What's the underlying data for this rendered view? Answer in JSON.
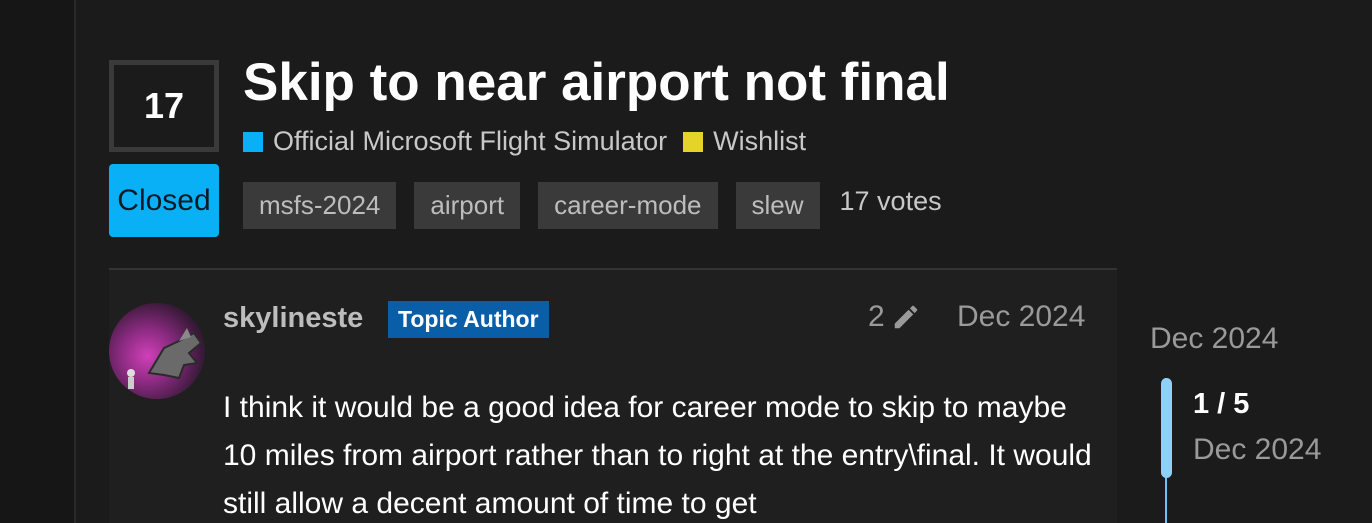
{
  "topic": {
    "vote_count": "17",
    "status": "Closed",
    "title": "Skip to near airport not final",
    "categories": [
      {
        "label": "Official Microsoft Flight Simulator",
        "color": "#0ab0f5"
      },
      {
        "label": "Wishlist",
        "color": "#e5d32a"
      }
    ],
    "tags": [
      "msfs-2024",
      "airport",
      "career-mode",
      "slew"
    ],
    "votes_text": "17 votes"
  },
  "post": {
    "username": "skylineste",
    "author_badge": "Topic Author",
    "edit_count": "2",
    "date": "Dec 2024",
    "body": "I think it would be a good idea for career mode to skip to maybe 10 miles from airport rather than to right at the entry\\final. It would still allow a decent amount of time to get"
  },
  "timeline": {
    "top_date": "Dec 2024",
    "position": "1 / 5",
    "current_date": "Dec 2024"
  }
}
